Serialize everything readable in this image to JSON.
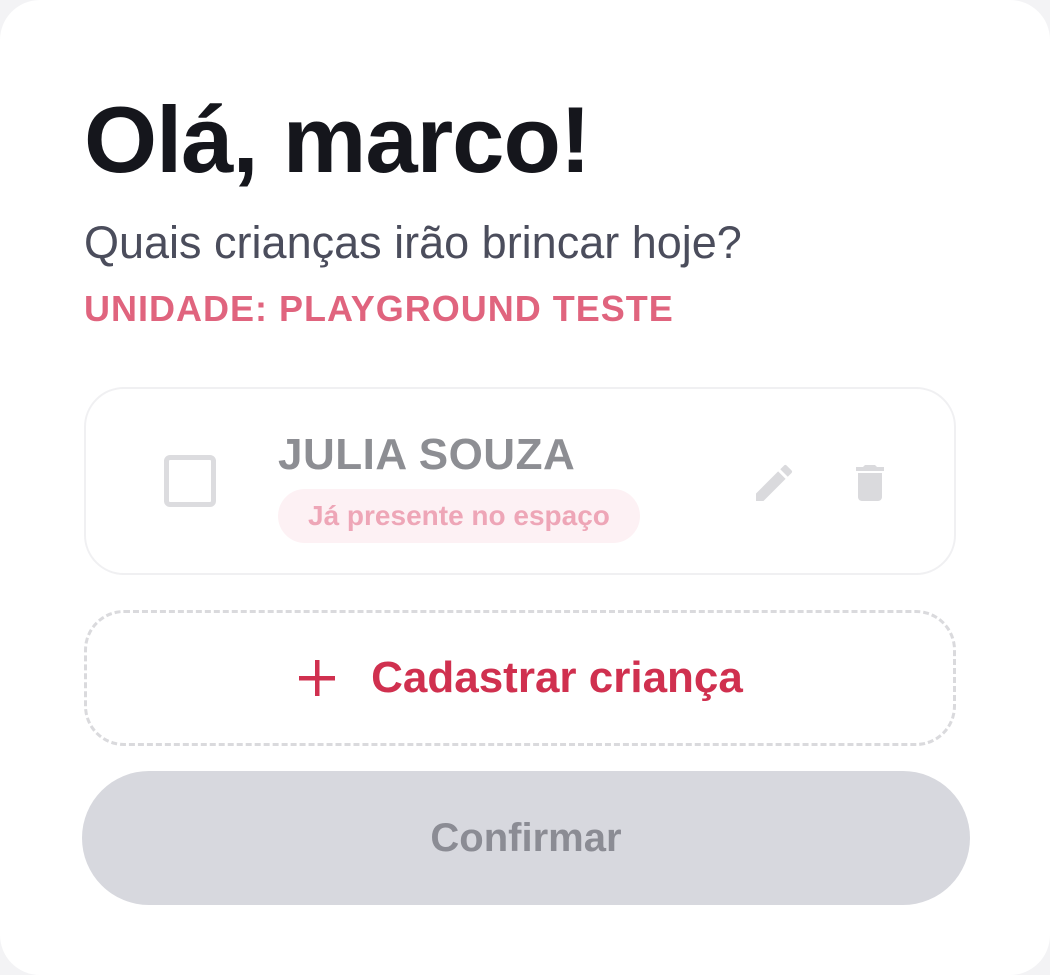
{
  "header": {
    "greeting": "Olá, marco!",
    "subtitle": "Quais crianças irão brincar hoje?",
    "unit_label": "UNIDADE: PLAYGROUND TESTE"
  },
  "children": [
    {
      "name": "JULIA SOUZA",
      "status": "Já presente no espaço",
      "checked": false,
      "edit_icon": "pencil-icon",
      "delete_icon": "trash-icon"
    }
  ],
  "actions": {
    "add_child_label": "Cadastrar criança",
    "add_icon": "plus-icon",
    "confirm_label": "Confirmar"
  },
  "colors": {
    "accent": "#d0304f",
    "unit_text": "#e0647e",
    "badge_bg": "#fdf1f4",
    "badge_text": "#eea6b7",
    "disabled_button": "#d7d8de"
  }
}
